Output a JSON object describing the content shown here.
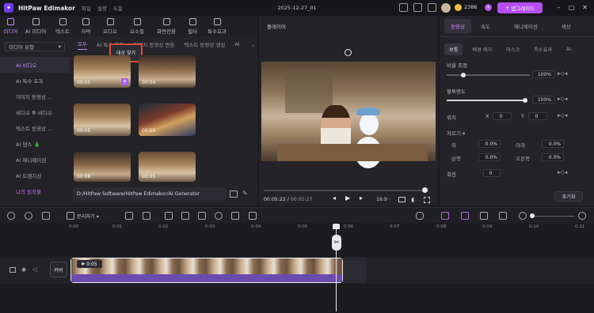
{
  "app": {
    "name": "HitPaw Edimakor",
    "menus": [
      "파일",
      "설정",
      "도움"
    ],
    "doc_title": "2025-12-27_01",
    "credits": "2386",
    "upgrade_label": "↑ 업그레이드"
  },
  "toolbar": {
    "items": [
      "미디어",
      "AI 미디어",
      "텍스트",
      "자막",
      "오디오",
      "요소들",
      "화면전환",
      "필터",
      "특수효과"
    ],
    "active": 0
  },
  "sidebar": {
    "dropdown": "미디어 유형",
    "items": [
      "AI 비디오",
      "AI 특수 효과",
      "이미지 동영상 ...",
      "비디오 투 비디오",
      "텍스트 동영상 ...",
      "AI 댄스 🎄",
      "AI 애니메이션",
      "AI 트랜지션",
      "나의 원작물"
    ],
    "selected": 0
  },
  "media": {
    "tabs": [
      "모두",
      "AI 특수 효과",
      "이미지 동영상 변환",
      "텍스트 동영상 생성",
      "AI"
    ],
    "selected_tab": 0,
    "tooltip": "대상 찾기",
    "thumbs": [
      "00:05",
      "00:04",
      "00:05",
      "00:05",
      "00:08",
      "00:05"
    ],
    "path": "D:/HitPaw Software/HitPaw Edimakor/AI Generator"
  },
  "player": {
    "title": "플레이어",
    "time_current": "00:05:22",
    "time_total": "00:05:27",
    "ratio": "16:9 ·"
  },
  "props": {
    "tabs": [
      "동영상",
      "속도",
      "애니메이션",
      "색상"
    ],
    "selected_tab": 0,
    "subtabs": [
      "보통",
      "배경 제거",
      "마스크",
      "특수효과",
      "AI"
    ],
    "selected_subtab": 0,
    "size_label": "비율 조정",
    "size_value": "100%",
    "opacity_label": "불투명도",
    "opacity_value": "100%",
    "position_label": "위치",
    "pos_x_label": "X",
    "pos_x": "0",
    "pos_y_label": "Y",
    "pos_y": "0",
    "crop_label": "자르기 ▾",
    "crop": [
      [
        "위",
        "0.0%"
      ],
      [
        "아래",
        "0.0%"
      ],
      [
        "왼쪽",
        "0.0%"
      ],
      [
        "오른쪽",
        "0.0%"
      ]
    ],
    "rotate_label": "회전",
    "rotate_value": "0",
    "reset_label": "초기화"
  },
  "timeline": {
    "split_label": "분리하기 ▾",
    "ticks": [
      "0:00",
      "0:01",
      "0:02",
      "0:03",
      "0:04",
      "0:05",
      "0:06",
      "0:07",
      "0:08",
      "0:09",
      "0:10",
      "0:11"
    ],
    "clip_duration": "0:05",
    "cover_label": "커버"
  }
}
